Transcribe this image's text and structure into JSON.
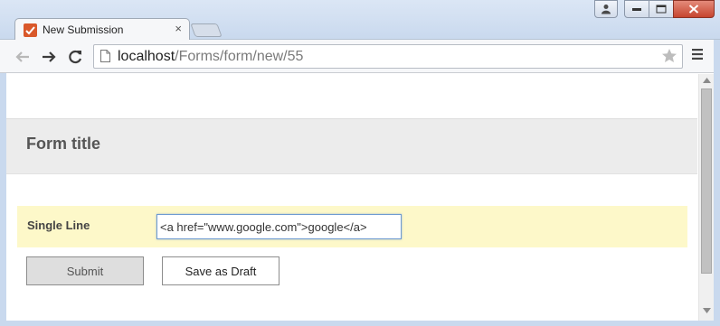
{
  "browser": {
    "tab_title": "New Submission",
    "tab_close": "×",
    "url_host": "localhost",
    "url_path": "/Forms/form/new/55"
  },
  "form": {
    "title": "Form title",
    "fields": [
      {
        "label": "Single Line",
        "value": "<a href=\"www.google.com\">google</a>"
      }
    ],
    "submit_label": "Submit",
    "draft_label": "Save as Draft"
  },
  "colors": {
    "favicon": "#d9582a",
    "field_highlight": "#fdf8c9",
    "header_bg": "#ececec"
  }
}
